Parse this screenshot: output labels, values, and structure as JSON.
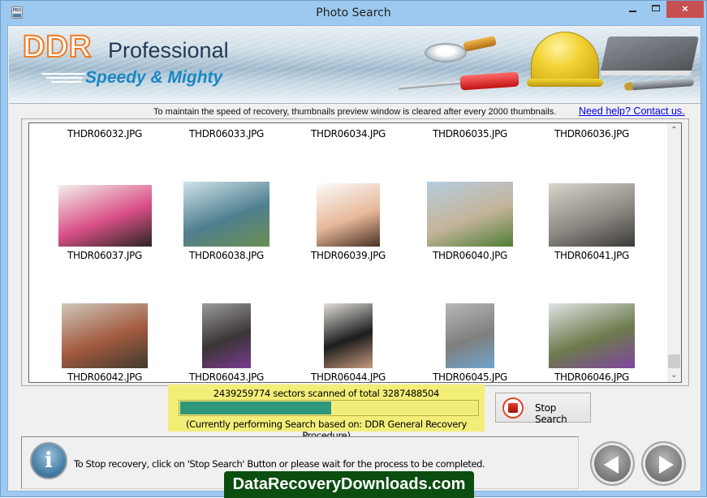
{
  "window": {
    "title": "Photo Search",
    "app_icon_text": "PRO",
    "controls": {
      "minimize": "minimize",
      "maximize": "maximize",
      "close": "×"
    }
  },
  "banner": {
    "brand": "DDR",
    "product": "Professional",
    "tagline": "Speedy & Mighty"
  },
  "notice": {
    "text": "To maintain the speed of recovery, thumbnails preview window is cleared after every 2000 thumbnails.",
    "help_link": "Need help? Contact us."
  },
  "thumbnails": [
    {
      "name": "THDR06032.JPG",
      "has_image": false
    },
    {
      "name": "THDR06033.JPG",
      "has_image": false
    },
    {
      "name": "THDR06034.JPG",
      "has_image": false
    },
    {
      "name": "THDR06035.JPG",
      "has_image": false
    },
    {
      "name": "THDR06036.JPG",
      "has_image": false
    },
    {
      "name": "THDR06037.JPG",
      "has_image": true,
      "subject": "pink rose beside teacup",
      "colors": [
        "#f3f0ea",
        "#d94f86",
        "#2a2622"
      ]
    },
    {
      "name": "THDR06038.JPG",
      "has_image": true,
      "subject": "glass office building",
      "colors": [
        "#cfe3ea",
        "#4f7f8f",
        "#6b8f52"
      ]
    },
    {
      "name": "THDR06039.JPG",
      "has_image": true,
      "subject": "crying child",
      "colors": [
        "#fbfbfb",
        "#e7b99a",
        "#4a2f22"
      ]
    },
    {
      "name": "THDR06040.JPG",
      "has_image": true,
      "subject": "castle tower with trees",
      "colors": [
        "#b5cde0",
        "#c4b49a",
        "#4f7d35"
      ]
    },
    {
      "name": "THDR06041.JPG",
      "has_image": true,
      "subject": "street with sky bridge",
      "colors": [
        "#d9d4cb",
        "#8d8a84",
        "#3c3a38"
      ]
    },
    {
      "name": "THDR06042.JPG",
      "has_image": true,
      "subject": "market stall",
      "colors": [
        "#cfc7bb",
        "#a25a3e",
        "#3f3a2f"
      ]
    },
    {
      "name": "THDR06043.JPG",
      "has_image": true,
      "subject": "people sitting on steps",
      "colors": [
        "#9b9b99",
        "#3a3535",
        "#7a3b8f"
      ]
    },
    {
      "name": "THDR06044.JPG",
      "has_image": true,
      "subject": "two women talking",
      "colors": [
        "#e2dfd8",
        "#1c1c1c",
        "#c79a80"
      ]
    },
    {
      "name": "THDR06045.JPG",
      "has_image": true,
      "subject": "stone bridge tower",
      "colors": [
        "#b7b7b5",
        "#7f7f7d",
        "#6fa6cf"
      ]
    },
    {
      "name": "THDR06046.JPG",
      "has_image": true,
      "subject": "festival crowd in costumes",
      "colors": [
        "#dfe4e5",
        "#6d7b4c",
        "#7f45a0"
      ]
    }
  ],
  "scan": {
    "sectors_text": "2439259774 sectors scanned of total 3287488504",
    "progress_percent": 51,
    "procedure_text": "(Currently performing Search based on:  DDR General Recovery Procedure)",
    "stop_button": "Stop Search"
  },
  "footer": {
    "info_text": "To Stop recovery, click on 'Stop Search' Button or please wait for the process to be completed.",
    "back_button": "back",
    "next_button": "next",
    "watermark": "DataRecoveryDownloads.com"
  },
  "colors": {
    "progress_fill": "#2e977c",
    "status_highlight": "#f3ee78",
    "close_button": "#c75050",
    "link": "#0000ee",
    "watermark_bg": "#0c4d10"
  }
}
